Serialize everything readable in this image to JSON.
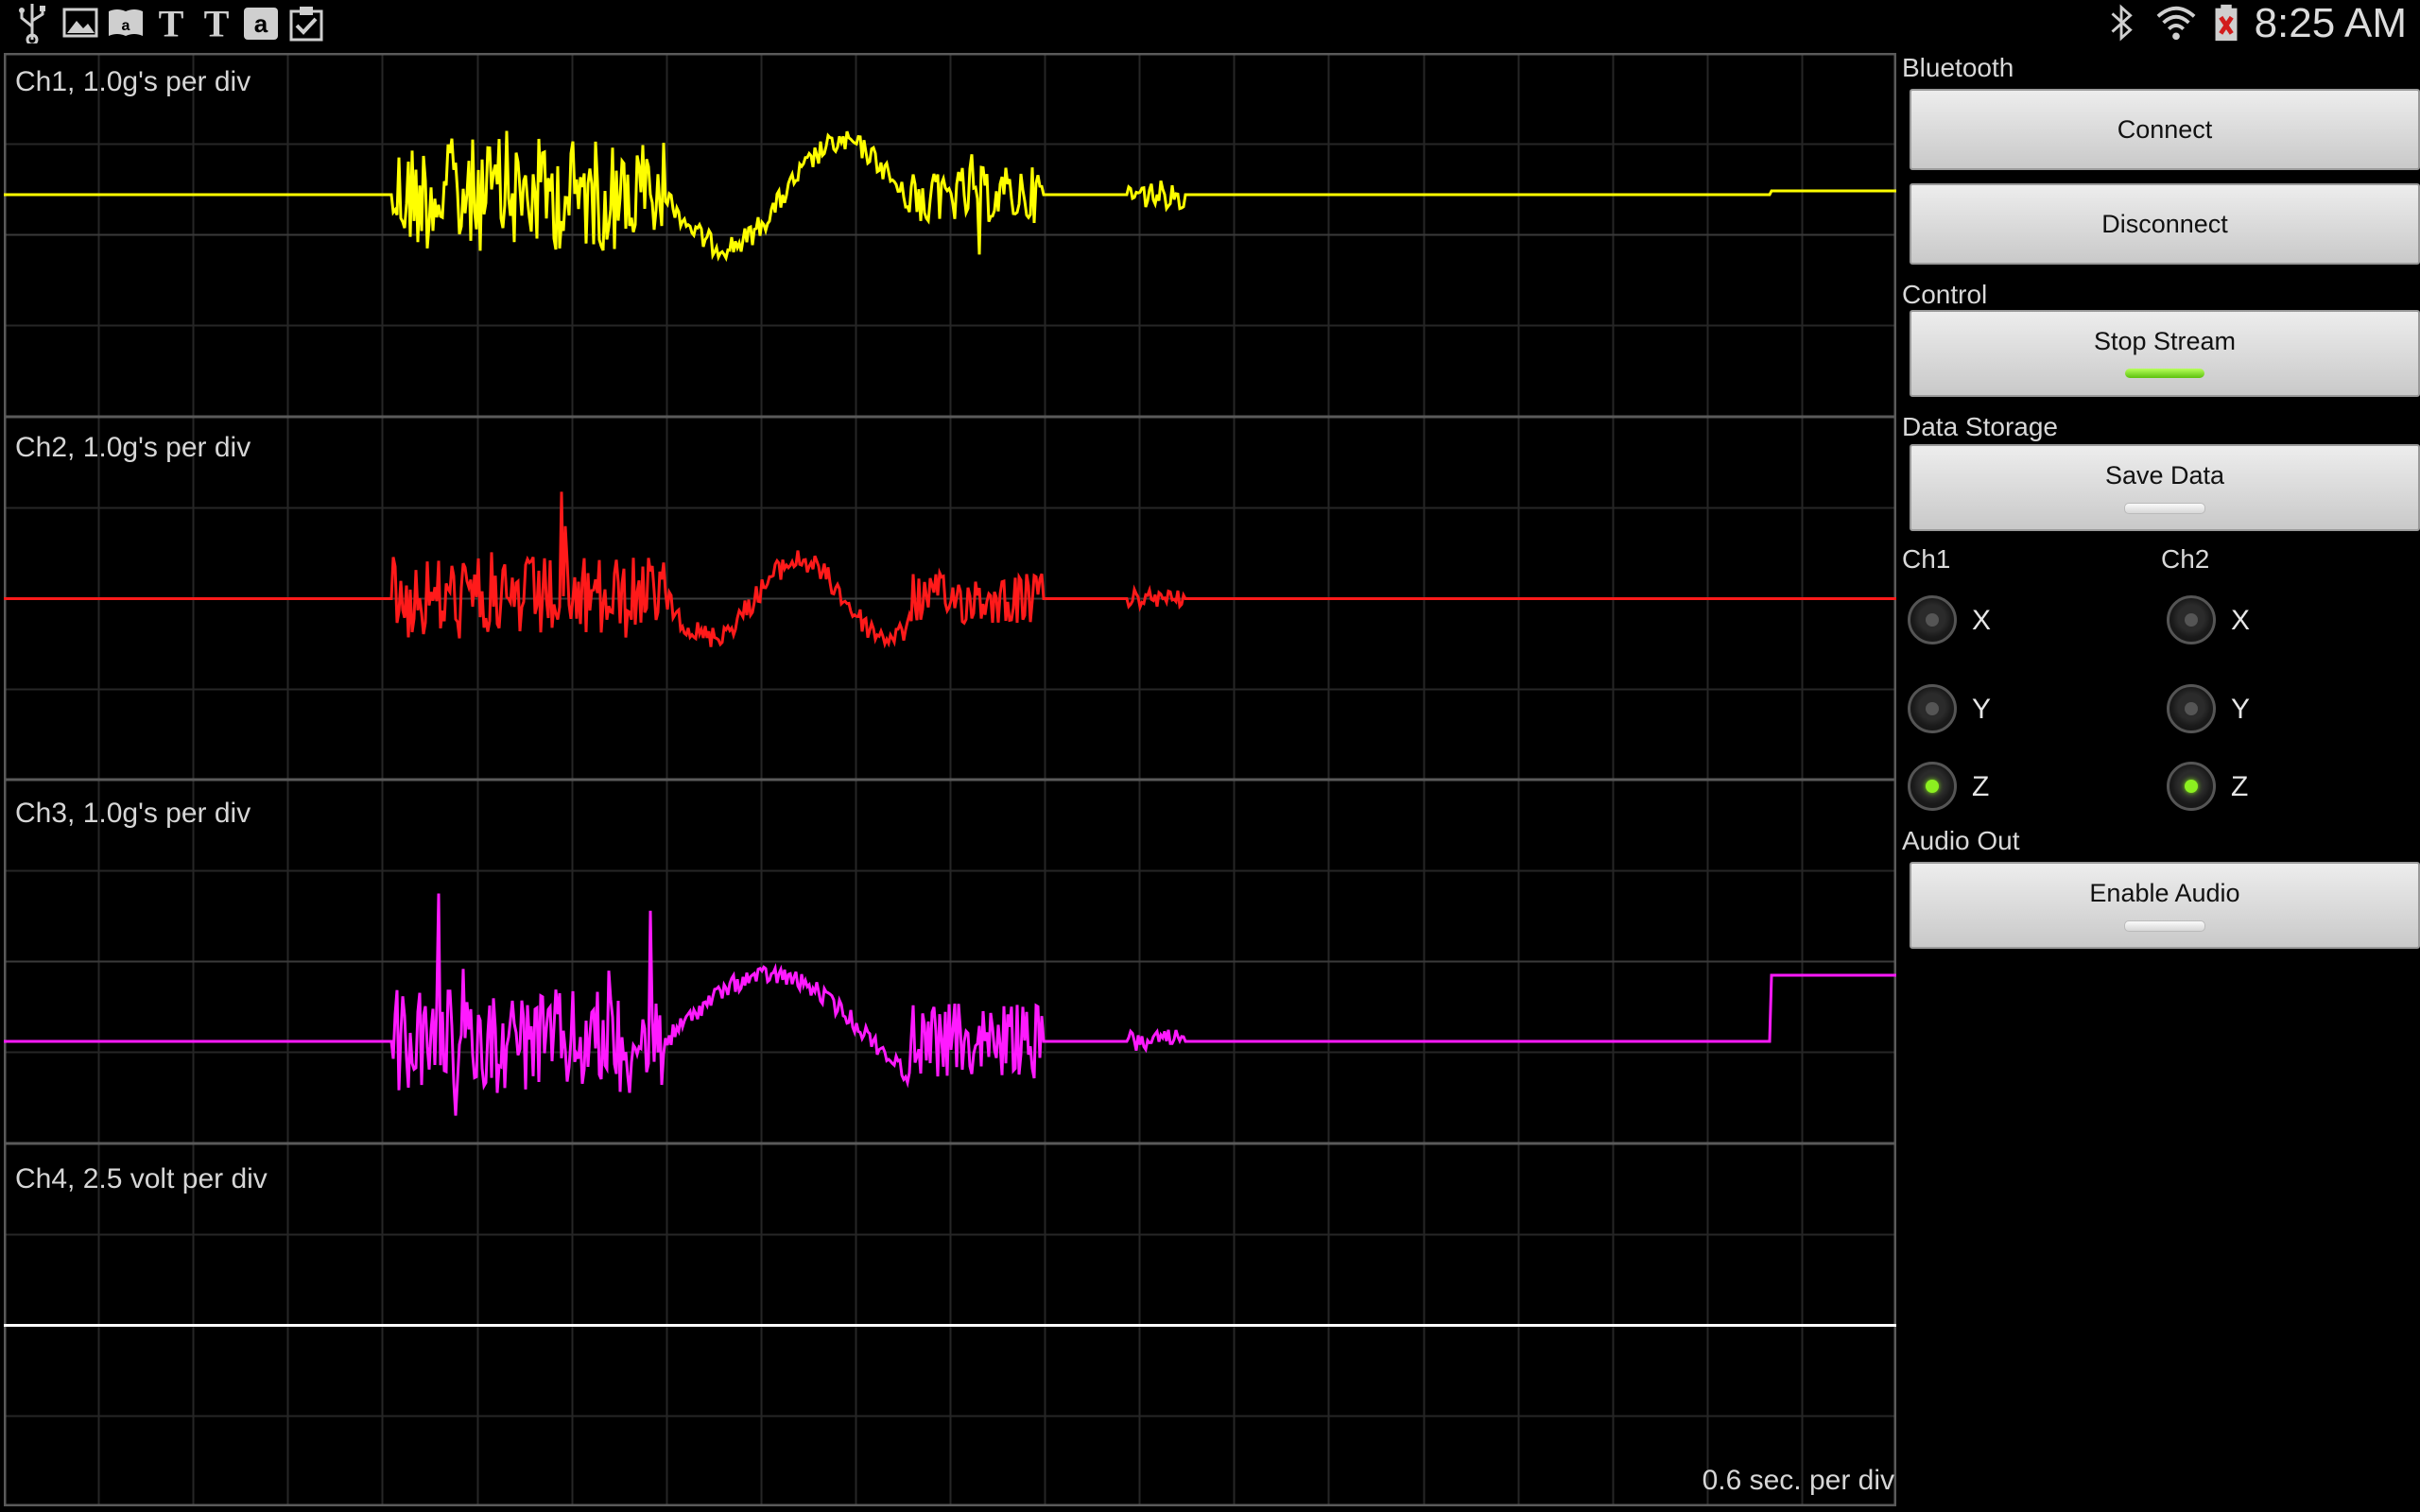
{
  "status_bar": {
    "time": "8:25 AM",
    "left_icons": [
      "usb-icon",
      "gallery-icon",
      "amazon-kindle-icon",
      "nytimes-icon",
      "nytimes-icon",
      "amazon-icon",
      "clipboard-check-icon"
    ],
    "right_icons": [
      "bluetooth-icon",
      "wifi-icon",
      "battery-icon"
    ]
  },
  "scope": {
    "channels": [
      {
        "label": "Ch1, 1.0g's per div",
        "color": "#ffff00"
      },
      {
        "label": "Ch2, 1.0g's per div",
        "color": "#ff1a1a"
      },
      {
        "label": "Ch3, 1.0g's per div",
        "color": "#ff1aff"
      },
      {
        "label": "Ch4, 2.5 volt per div",
        "color": "#ffffff"
      }
    ],
    "timebase": "0.6 sec. per div"
  },
  "panel": {
    "bluetooth": {
      "title": "Bluetooth",
      "connect": "Connect",
      "disconnect": "Disconnect"
    },
    "control": {
      "title": "Control",
      "stop_stream": "Stop Stream",
      "stream_active": true
    },
    "data_storage": {
      "title": "Data Storage",
      "save_data": "Save Data",
      "saving": false
    },
    "axes": {
      "ch1_title": "Ch1",
      "ch2_title": "Ch2",
      "options": [
        "X",
        "Y",
        "Z"
      ],
      "ch1_selected": "Z",
      "ch2_selected": "Z"
    },
    "audio": {
      "title": "Audio Out",
      "enable_audio": "Enable Audio",
      "enabled": false
    }
  }
}
